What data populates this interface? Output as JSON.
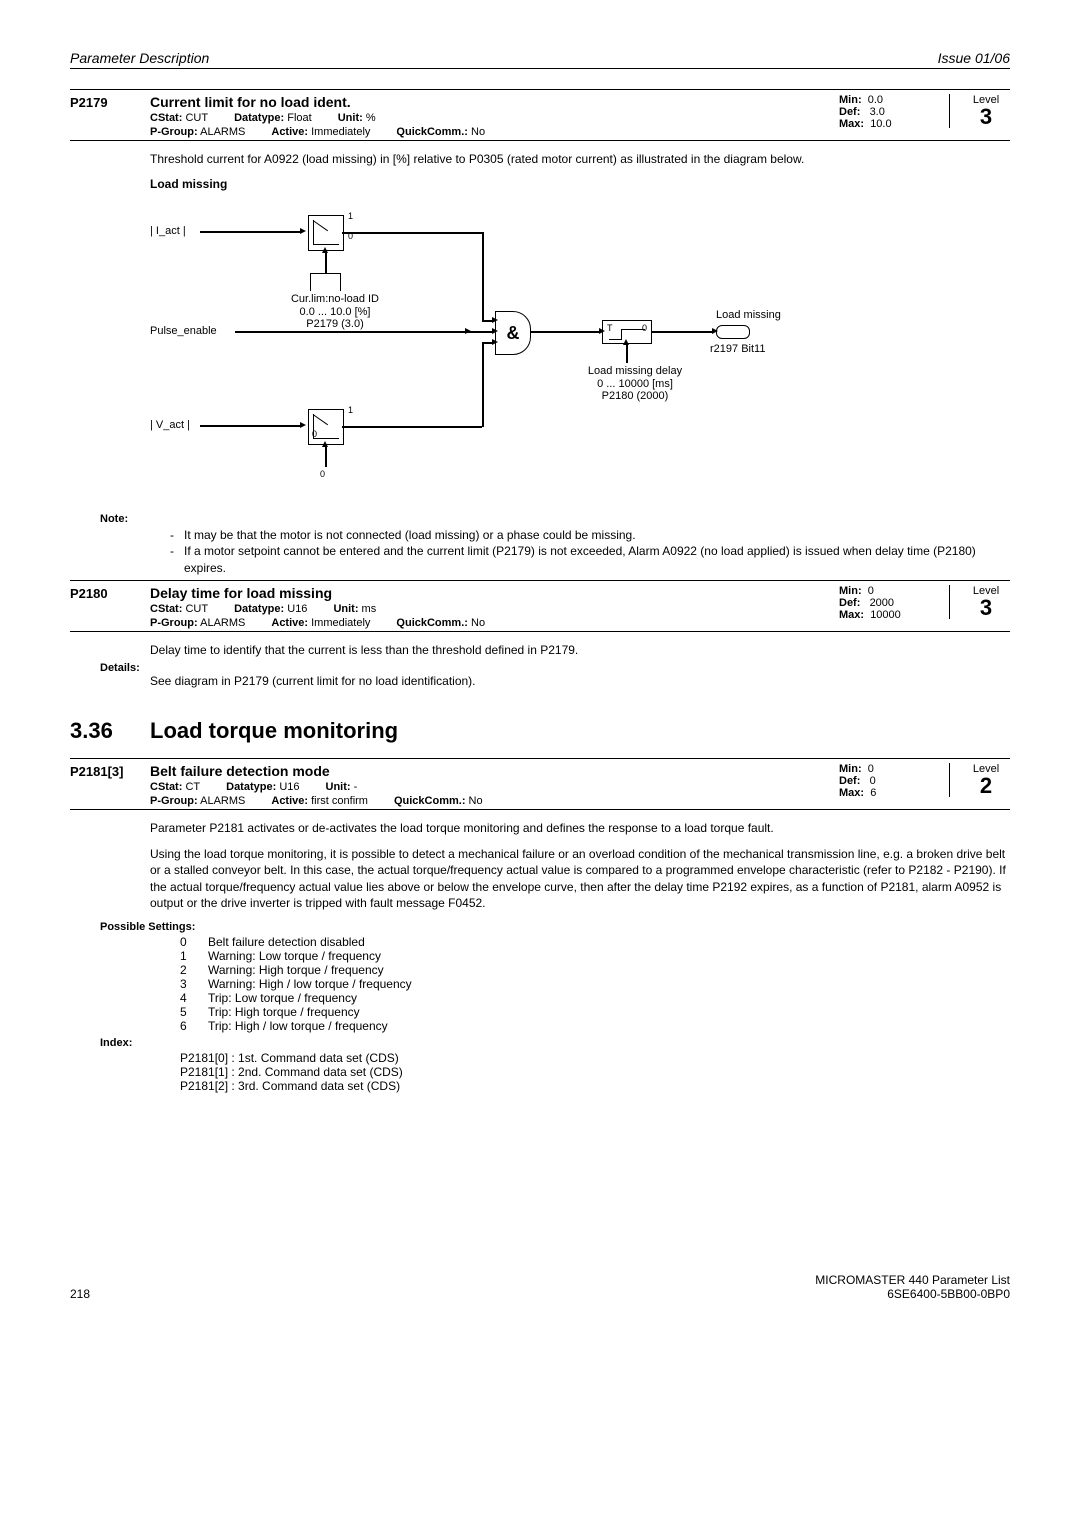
{
  "header": {
    "left": "Parameter Description",
    "right": "Issue 01/06"
  },
  "p2179": {
    "id": "P2179",
    "title": "Current limit for no load ident.",
    "cstat": "CUT",
    "pgroup": "ALARMS",
    "datatype": "Float",
    "active": "Immediately",
    "unit": "%",
    "quickcomm": "No",
    "min": "0.0",
    "def": "3.0",
    "max": "10.0",
    "level": "3",
    "desc": "Threshold current for A0922 (load missing) in [%] relative to P0305 (rated motor current) as illustrated in the diagram below.",
    "diag_title": "Load missing",
    "diag": {
      "i_act": "| I_act |",
      "pulse": "Pulse_enable",
      "v_act": "| V_act |",
      "curlim1": "Cur.lim:no-load ID",
      "curlim2": "0.0 ... 10.0 [%]",
      "curlim3": "P2179 (3.0)",
      "delay1": "Load missing delay",
      "delay2": "0 ... 10000 [ms]",
      "delay3": "P2180 (2000)",
      "loadmiss": "Load missing",
      "bit": "r2197 Bit11",
      "and": "&",
      "t": "T",
      "zero": "0",
      "one": "1"
    },
    "note_label": "Note:",
    "notes": [
      "It may be that the motor is not connected (load missing) or a phase could be missing.",
      "If a motor setpoint cannot be entered and the current limit (P2179) is not exceeded, Alarm A0922 (no load applied) is issued when delay time (P2180) expires."
    ]
  },
  "p2180": {
    "id": "P2180",
    "title": "Delay time for load missing",
    "cstat": "CUT",
    "pgroup": "ALARMS",
    "datatype": "U16",
    "active": "Immediately",
    "unit": "ms",
    "quickcomm": "No",
    "min": "0",
    "def": "2000",
    "max": "10000",
    "level": "3",
    "desc": "Delay time to identify that the current is less than the threshold defined in P2179.",
    "details_label": "Details:",
    "details": "See diagram in P2179 (current limit for no load identification)."
  },
  "section": {
    "num": "3.36",
    "title": "Load torque monitoring"
  },
  "p2181": {
    "id": "P2181[3]",
    "title": "Belt failure detection mode",
    "cstat": "CT",
    "pgroup": "ALARMS",
    "datatype": "U16",
    "active": "first confirm",
    "unit": "-",
    "quickcomm": "No",
    "min": "0",
    "def": "0",
    "max": "6",
    "level": "2",
    "desc1": "Parameter P2181 activates or de-activates the load torque monitoring and defines the response to a load torque fault.",
    "desc2": "Using the load torque monitoring, it is possible to detect a mechanical failure or an overload condition of the mechanical transmission line, e.g. a broken drive belt or a stalled conveyor belt. In this case, the actual torque/frequency actual value is compared to a programmed envelope characteristic (refer to P2182 - P2190). If the actual torque/frequency actual value lies above or below the envelope curve, then after the delay time P2192 expires, as a function of P2181, alarm A0952 is output or the drive inverter is tripped with fault message F0452.",
    "settings_label": "Possible Settings:",
    "settings": [
      [
        "0",
        "Belt failure detection disabled"
      ],
      [
        "1",
        "Warning: Low torque / frequency"
      ],
      [
        "2",
        "Warning: High torque / frequency"
      ],
      [
        "3",
        "Warning: High / low torque / frequency"
      ],
      [
        "4",
        "Trip: Low torque / frequency"
      ],
      [
        "5",
        "Trip: High torque / frequency"
      ],
      [
        "6",
        "Trip: High / low torque / frequency"
      ]
    ],
    "index_label": "Index:",
    "index": [
      "P2181[0] :  1st. Command data set (CDS)",
      "P2181[1] :  2nd. Command data set (CDS)",
      "P2181[2] :  3rd. Command data set (CDS)"
    ]
  },
  "footer": {
    "page": "218",
    "line1": "MICROMASTER 440    Parameter List",
    "line2": "6SE6400-5BB00-0BP0"
  },
  "labels": {
    "cstat": "CStat:",
    "pgroup": "P-Group:",
    "datatype": "Datatype:",
    "active": "Active:",
    "unit": "Unit:",
    "quickcomm": "QuickComm.:",
    "min": "Min:",
    "def": "Def:",
    "max": "Max:",
    "level": "Level"
  }
}
